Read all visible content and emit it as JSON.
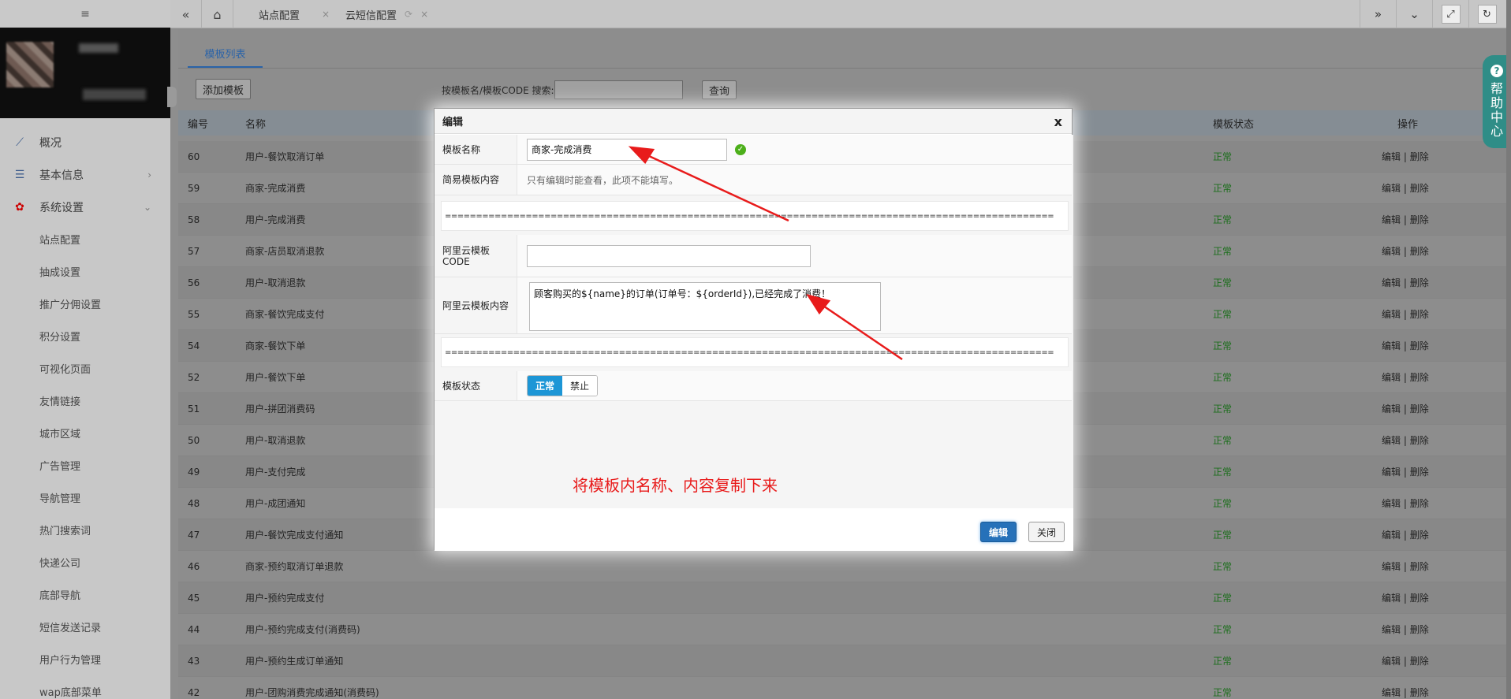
{
  "sidebar": {
    "top_icon": "≡",
    "menu": [
      {
        "label": "概况",
        "icon": "chart-line-icon",
        "glyph": "📈"
      },
      {
        "label": "基本信息",
        "icon": "list-icon",
        "glyph": "☰",
        "arrow": "›"
      },
      {
        "label": "系统设置",
        "icon": "gear-icon",
        "glyph": "✿",
        "arrow": "⌄"
      }
    ],
    "sub_items": [
      "站点配置",
      "抽成设置",
      "推广分佣设置",
      "积分设置",
      "可视化页面",
      "友情链接",
      "城市区域",
      "广告管理",
      "导航管理",
      "热门搜索词",
      "快递公司",
      "底部导航",
      "短信发送记录",
      "用户行为管理",
      "wap底部菜单"
    ]
  },
  "topbar": {
    "back": "«",
    "home": "⌂",
    "tabs": [
      {
        "label": "站点配置",
        "close": "×"
      },
      {
        "label": "云短信配置",
        "refresh": "⟳",
        "close": "×"
      }
    ],
    "forward": "»",
    "dropdown": "⌄",
    "fullscreen": "⤢",
    "reload": "↻"
  },
  "main": {
    "subtab": "模板列表",
    "add_button": "添加模板",
    "search_label": "按模板名/模板CODE 搜索:",
    "search_value": "",
    "search_button": "查询",
    "columns": {
      "id": "编号",
      "name": "名称",
      "status": "模板状态",
      "ops": "操作"
    },
    "rows": [
      {
        "id": "60",
        "name": "用户-餐饮取消订单",
        "status": "正常"
      },
      {
        "id": "59",
        "name": "商家-完成消费",
        "status": "正常"
      },
      {
        "id": "58",
        "name": "用户-完成消费",
        "status": "正常"
      },
      {
        "id": "57",
        "name": "商家-店员取消退款",
        "status": "正常"
      },
      {
        "id": "56",
        "name": "用户-取消退款",
        "status": "正常"
      },
      {
        "id": "55",
        "name": "商家-餐饮完成支付",
        "status": "正常"
      },
      {
        "id": "54",
        "name": "商家-餐饮下单",
        "status": "正常"
      },
      {
        "id": "52",
        "name": "用户-餐饮下单",
        "status": "正常"
      },
      {
        "id": "51",
        "name": "用户-拼团消费码",
        "status": "正常"
      },
      {
        "id": "50",
        "name": "用户-取消退款",
        "status": "正常"
      },
      {
        "id": "49",
        "name": "用户-支付完成",
        "status": "正常"
      },
      {
        "id": "48",
        "name": "用户-成团通知",
        "status": "正常"
      },
      {
        "id": "47",
        "name": "用户-餐饮完成支付通知",
        "status": "正常"
      },
      {
        "id": "46",
        "name": "商家-预约取消订单退款",
        "status": "正常"
      },
      {
        "id": "45",
        "name": "用户-预约完成支付",
        "status": "正常"
      },
      {
        "id": "44",
        "name": "用户-预约完成支付(消费码)",
        "status": "正常"
      },
      {
        "id": "43",
        "name": "用户-预约生成订单通知",
        "status": "正常"
      },
      {
        "id": "42",
        "name": "用户-团购消费完成通知(消费码)",
        "status": "正常"
      }
    ],
    "op_edit": "编辑",
    "op_sep": "|",
    "op_delete": "删除"
  },
  "help": {
    "q": "?",
    "label": [
      "帮",
      "助",
      "中",
      "心"
    ]
  },
  "modal": {
    "title": "编辑",
    "close": "x",
    "fields": {
      "name_label": "模板名称",
      "name_value": "商家-完成消费",
      "simple_label": "简易模板内容",
      "simple_hint": "只有编辑时能查看，此项不能填写。",
      "separator": "==================================================================================================",
      "code_label": "阿里云模板CODE",
      "code_value": "",
      "content_label": "阿里云模板内容",
      "content_value": "顾客购买的${name}的订单(订单号：${orderId}),已经完成了消费！",
      "status_label": "模板状态",
      "status_on": "正常",
      "status_off": "禁止"
    },
    "annotation": "将模板内名称、内容复制下来",
    "annotation_color": "#e81b1b",
    "edit_button": "编辑",
    "close_button": "关闭"
  },
  "colors": {
    "accent": "#2a63a8",
    "status_ok": "#1c6e1c",
    "primary_button": "#2671b9"
  }
}
